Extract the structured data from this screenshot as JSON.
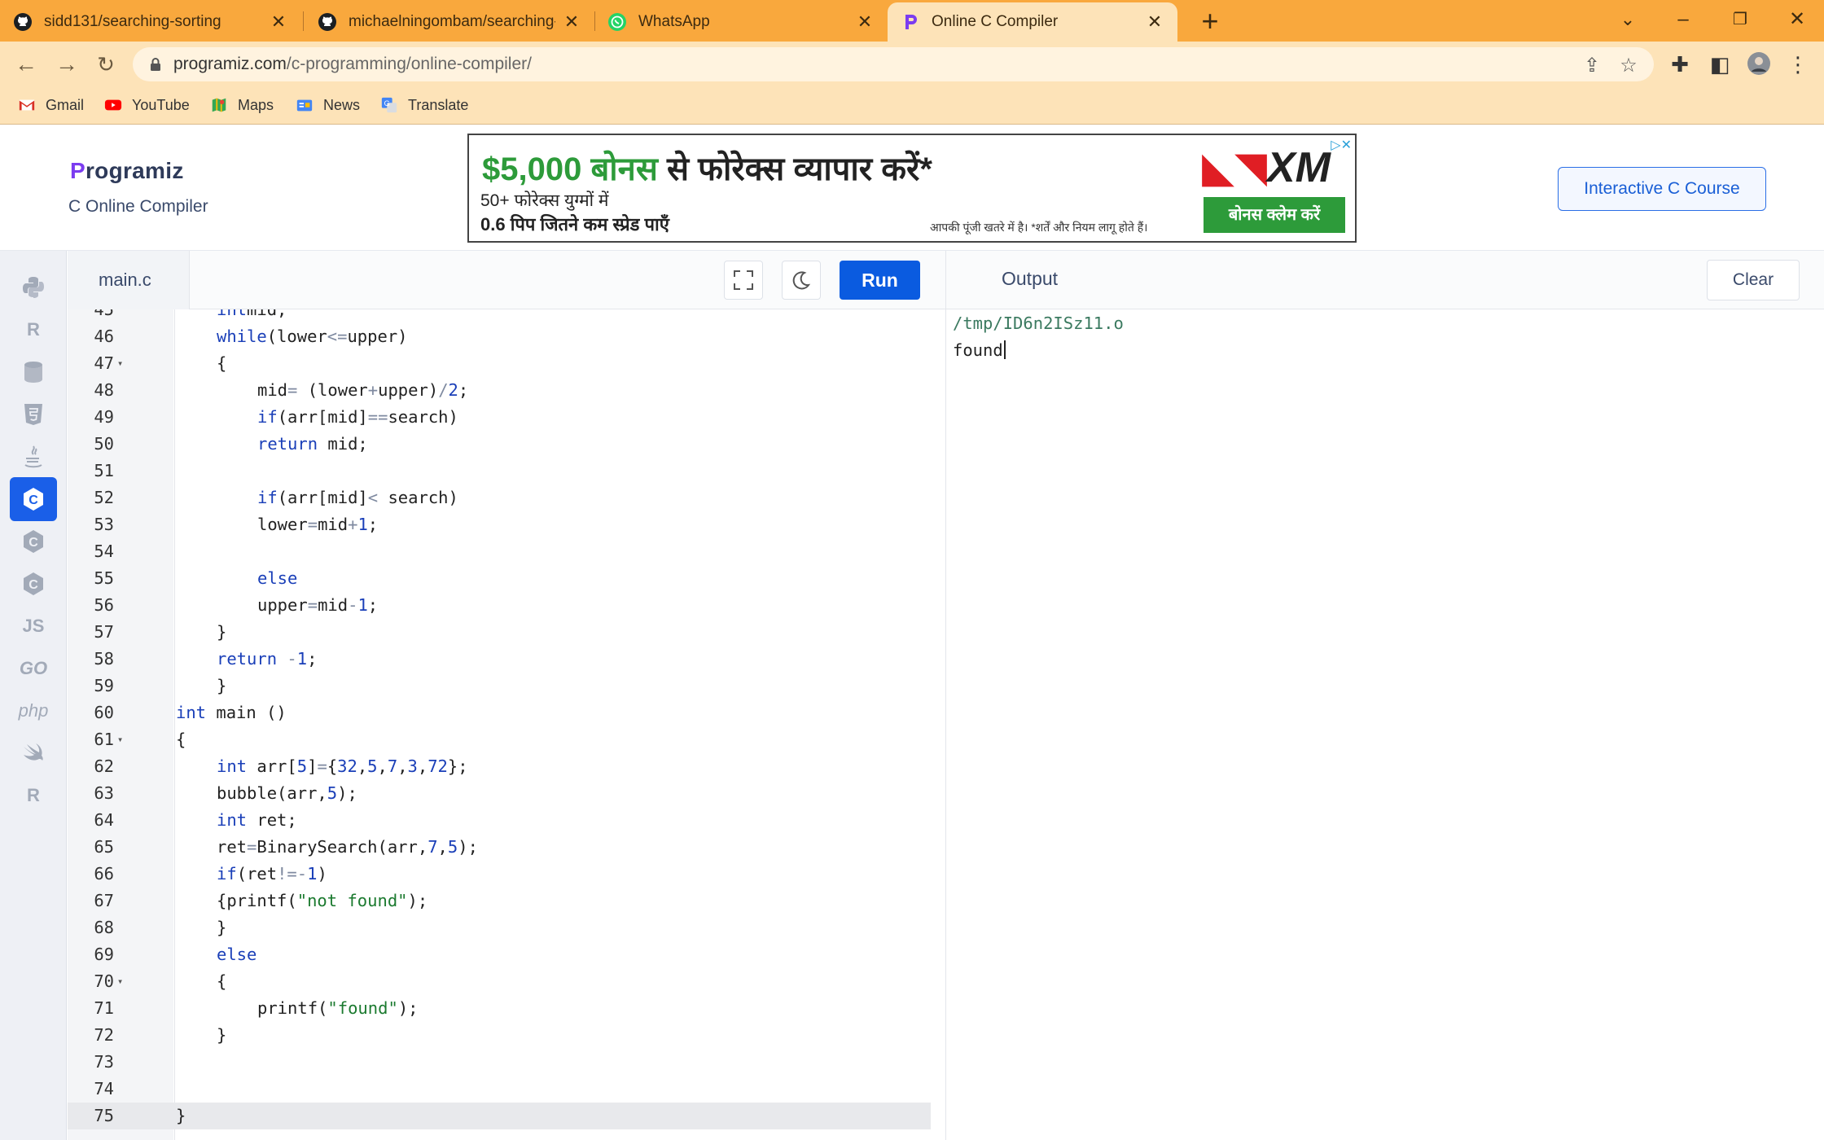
{
  "browser": {
    "tabs": [
      {
        "title": "sidd131/searching-sorting",
        "icon": "github-icon",
        "active": false
      },
      {
        "title": "michaelningombam/searching-s",
        "icon": "github-icon",
        "active": false
      },
      {
        "title": "WhatsApp",
        "icon": "whatsapp-icon",
        "active": false
      },
      {
        "title": "Online C Compiler",
        "icon": "programiz-icon",
        "active": true
      }
    ],
    "url_host": "programiz.com",
    "url_path": "/c-programming/online-compiler/",
    "bookmarks": [
      {
        "label": "Gmail",
        "icon": "gmail-icon",
        "color": "#d93025"
      },
      {
        "label": "YouTube",
        "icon": "youtube-icon",
        "color": "#ff0000"
      },
      {
        "label": "Maps",
        "icon": "maps-icon",
        "color": "#34a853"
      },
      {
        "label": "News",
        "icon": "news-icon",
        "color": "#4285f4"
      },
      {
        "label": "Translate",
        "icon": "translate-icon",
        "color": "#4285f4"
      }
    ],
    "accent_color": "#f9a83d"
  },
  "site": {
    "logo_text": "rogramiz",
    "logo_initial": "P",
    "subtitle": "C Online Compiler",
    "course_button": "Interactive C Course"
  },
  "ad": {
    "headline_amount": "$5,000 बोनस",
    "headline_rest": " से फोरेक्स व्यापार करें*",
    "line2": "50+ फोरेक्स युग्मों में",
    "line3": "0.6 पिप जितने कम स्प्रेड पाएँ",
    "disclaimer": "आपकी पूंजी खतरे में है। *शर्तें और नियम लागू होते हैं।",
    "brand": "XM",
    "cta": "बोनस क्लेम करें"
  },
  "languages": [
    {
      "name": "python-icon",
      "label": "",
      "active": false
    },
    {
      "name": "r-icon",
      "label": "R",
      "active": false
    },
    {
      "name": "sql-icon",
      "label": "",
      "active": false
    },
    {
      "name": "html5-icon",
      "label": "5",
      "active": false
    },
    {
      "name": "java-icon",
      "label": "",
      "active": false
    },
    {
      "name": "c-icon",
      "label": "C",
      "active": true
    },
    {
      "name": "cpp-icon",
      "label": "C",
      "active": false
    },
    {
      "name": "csharp-icon",
      "label": "C",
      "active": false
    },
    {
      "name": "js-icon",
      "label": "JS",
      "active": false
    },
    {
      "name": "go-icon",
      "label": "GO",
      "active": false
    },
    {
      "name": "php-icon",
      "label": "php",
      "active": false
    },
    {
      "name": "swift-icon",
      "label": "",
      "active": false
    },
    {
      "name": "rust-icon",
      "label": "R",
      "active": false
    }
  ],
  "editor": {
    "file_name": "main.c",
    "run_label": "Run",
    "current_line": 75,
    "lines": [
      {
        "n": "45",
        "indent": 1,
        "tokens": [
          [
            "kw",
            "int"
          ],
          [
            "",
            "mid;"
          ]
        ],
        "fold": false
      },
      {
        "n": "46",
        "indent": 1,
        "tokens": [
          [
            "kw",
            "while"
          ],
          [
            "",
            "(lower"
          ],
          [
            "op",
            "<="
          ],
          [
            "",
            "upper)"
          ]
        ],
        "fold": false
      },
      {
        "n": "47",
        "indent": 1,
        "tokens": [
          [
            "",
            "{"
          ]
        ],
        "fold": true
      },
      {
        "n": "48",
        "indent": 2,
        "tokens": [
          [
            "",
            "mid"
          ],
          [
            "op",
            "="
          ],
          [
            "",
            " (lower"
          ],
          [
            "op",
            "+"
          ],
          [
            "",
            "upper)"
          ],
          [
            "op",
            "/"
          ],
          [
            "num",
            "2"
          ],
          [
            "",
            ";"
          ]
        ],
        "fold": false
      },
      {
        "n": "49",
        "indent": 2,
        "tokens": [
          [
            "kw",
            "if"
          ],
          [
            "",
            "(arr[mid]"
          ],
          [
            "op",
            "=="
          ],
          [
            "",
            "search)"
          ]
        ],
        "fold": false
      },
      {
        "n": "50",
        "indent": 2,
        "tokens": [
          [
            "kw",
            "return"
          ],
          [
            "",
            " mid;"
          ]
        ],
        "fold": false
      },
      {
        "n": "51",
        "indent": 2,
        "tokens": [],
        "fold": false
      },
      {
        "n": "52",
        "indent": 2,
        "tokens": [
          [
            "kw",
            "if"
          ],
          [
            "",
            "(arr[mid]"
          ],
          [
            "op",
            "<"
          ],
          [
            "",
            " search)"
          ]
        ],
        "fold": false
      },
      {
        "n": "53",
        "indent": 2,
        "tokens": [
          [
            "",
            "lower"
          ],
          [
            "op",
            "="
          ],
          [
            "",
            "mid"
          ],
          [
            "op",
            "+"
          ],
          [
            "num",
            "1"
          ],
          [
            "",
            ";"
          ]
        ],
        "fold": false
      },
      {
        "n": "54",
        "indent": 2,
        "tokens": [],
        "fold": false
      },
      {
        "n": "55",
        "indent": 2,
        "tokens": [
          [
            "kw",
            "else"
          ]
        ],
        "fold": false
      },
      {
        "n": "56",
        "indent": 2,
        "tokens": [
          [
            "",
            "upper"
          ],
          [
            "op",
            "="
          ],
          [
            "",
            "mid"
          ],
          [
            "op",
            "-"
          ],
          [
            "num",
            "1"
          ],
          [
            "",
            ";"
          ]
        ],
        "fold": false
      },
      {
        "n": "57",
        "indent": 1,
        "tokens": [
          [
            "",
            "}"
          ]
        ],
        "fold": false
      },
      {
        "n": "58",
        "indent": 1,
        "tokens": [
          [
            "kw",
            "return"
          ],
          [
            "",
            " "
          ],
          [
            "op",
            "-"
          ],
          [
            "num",
            "1"
          ],
          [
            "",
            ";"
          ]
        ],
        "fold": false
      },
      {
        "n": "59",
        "indent": 1,
        "tokens": [
          [
            "",
            "}"
          ]
        ],
        "fold": false
      },
      {
        "n": "60",
        "indent": 0,
        "tokens": [
          [
            "kw",
            "int"
          ],
          [
            "",
            " main ()"
          ]
        ],
        "fold": false
      },
      {
        "n": "61",
        "indent": 0,
        "tokens": [
          [
            "",
            "{"
          ]
        ],
        "fold": true
      },
      {
        "n": "62",
        "indent": 1,
        "tokens": [
          [
            "kw",
            "int"
          ],
          [
            "",
            " arr["
          ],
          [
            "num",
            "5"
          ],
          [
            "",
            "]"
          ],
          [
            "op",
            "="
          ],
          [
            "",
            "{"
          ],
          [
            "num",
            "32"
          ],
          [
            "",
            ","
          ],
          [
            "num",
            "5"
          ],
          [
            "",
            ","
          ],
          [
            "num",
            "7"
          ],
          [
            "",
            ","
          ],
          [
            "num",
            "3"
          ],
          [
            "",
            ","
          ],
          [
            "num",
            "72"
          ],
          [
            "",
            "};"
          ]
        ],
        "fold": false
      },
      {
        "n": "63",
        "indent": 1,
        "tokens": [
          [
            "",
            "bubble(arr,"
          ],
          [
            "num",
            "5"
          ],
          [
            "",
            ");"
          ]
        ],
        "fold": false
      },
      {
        "n": "64",
        "indent": 1,
        "tokens": [
          [
            "kw",
            "int"
          ],
          [
            "",
            " ret;"
          ]
        ],
        "fold": false
      },
      {
        "n": "65",
        "indent": 1,
        "tokens": [
          [
            "",
            "ret"
          ],
          [
            "op",
            "="
          ],
          [
            "",
            "BinarySearch(arr,"
          ],
          [
            "num",
            "7"
          ],
          [
            "",
            ","
          ],
          [
            "num",
            "5"
          ],
          [
            "",
            ");"
          ]
        ],
        "fold": false
      },
      {
        "n": "66",
        "indent": 1,
        "tokens": [
          [
            "kw",
            "if"
          ],
          [
            "",
            "(ret"
          ],
          [
            "op",
            "!="
          ],
          [
            "op",
            "-"
          ],
          [
            "num",
            "1"
          ],
          [
            "",
            ")"
          ]
        ],
        "fold": false
      },
      {
        "n": "67",
        "indent": 1,
        "tokens": [
          [
            "",
            "{printf("
          ],
          [
            "str",
            "\"not found\""
          ],
          [
            "",
            ");"
          ]
        ],
        "fold": false
      },
      {
        "n": "68",
        "indent": 1,
        "tokens": [
          [
            "",
            "}"
          ]
        ],
        "fold": false
      },
      {
        "n": "69",
        "indent": 1,
        "tokens": [
          [
            "kw",
            "else"
          ]
        ],
        "fold": false
      },
      {
        "n": "70",
        "indent": 1,
        "tokens": [
          [
            "",
            "{"
          ]
        ],
        "fold": true
      },
      {
        "n": "71",
        "indent": 2,
        "tokens": [
          [
            "",
            "printf("
          ],
          [
            "str",
            "\"found\""
          ],
          [
            "",
            ");"
          ]
        ],
        "fold": false
      },
      {
        "n": "72",
        "indent": 1,
        "tokens": [
          [
            "",
            "}"
          ]
        ],
        "fold": false
      },
      {
        "n": "73",
        "indent": 0,
        "tokens": [],
        "fold": false
      },
      {
        "n": "74",
        "indent": 0,
        "tokens": [],
        "fold": false
      },
      {
        "n": "75",
        "indent": 0,
        "tokens": [
          [
            "",
            "}"
          ]
        ],
        "fold": false
      }
    ]
  },
  "output": {
    "title": "Output",
    "clear_label": "Clear",
    "path": "/tmp/ID6n2ISz11.o",
    "text": "found"
  }
}
